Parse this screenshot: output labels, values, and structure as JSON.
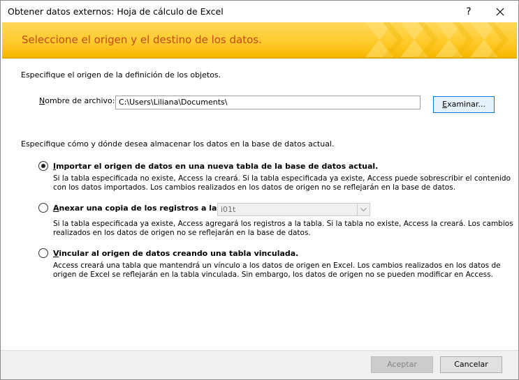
{
  "window": {
    "title": "Obtener datos externos: Hoja de cálculo de Excel",
    "help_label": "?"
  },
  "banner": {
    "title": "Seleccione el origen y el destino de los datos."
  },
  "source": {
    "instruction": "Especifique el origen de la definición de los objetos.",
    "filename_label_first": "N",
    "filename_label_rest": "ombre de archivo:",
    "filename_value": "C:\\Users\\Liliana\\Documents\\",
    "browse_first": "E",
    "browse_rest": "xaminar..."
  },
  "destination": {
    "instruction": "Especifique cómo y dónde desea almacenar los datos en la base de datos actual.",
    "options": [
      {
        "label_first": "I",
        "label_rest": "mportar el origen de datos en una nueva tabla de la base de datos actual.",
        "selected": true,
        "desc_line1": "Si la tabla especificada no existe, Access la creará. Si la tabla especificada ya existe, Access puede sobrescribir el contenido",
        "desc_line2": "con los datos importados. Los cambios realizados en los datos de origen no se reflejarán en la base de datos."
      },
      {
        "label_first": "A",
        "label_rest": "nexar una copia de los registros a la tabla:",
        "selected": false,
        "table_value": "i01t",
        "desc_line1": "Si la tabla especificada ya existe, Access agregará los registros a la tabla. Si la tabla no existe, Access la creará. Los cambios",
        "desc_line2": "realizados en los datos de origen no se reflejarán en la base de datos."
      },
      {
        "label_first": "V",
        "label_rest": "incular al origen de datos creando una tabla vinculada.",
        "selected": false,
        "desc_line1": "Access creará una tabla que mantendrá un vínculo a los datos de origen en Excel. Los cambios realizados en los datos de",
        "desc_line2": "origen de Excel se reflejarán en la tabla vinculada. Sin embargo, los datos de origen no se pueden modificar en Access."
      }
    ]
  },
  "footer": {
    "ok_label": "Aceptar",
    "cancel_label": "Cancelar"
  },
  "colors": {
    "banner_title": "#c34a1b",
    "banner_bg": "#ffc929",
    "focus_blue": "#0078d7"
  }
}
